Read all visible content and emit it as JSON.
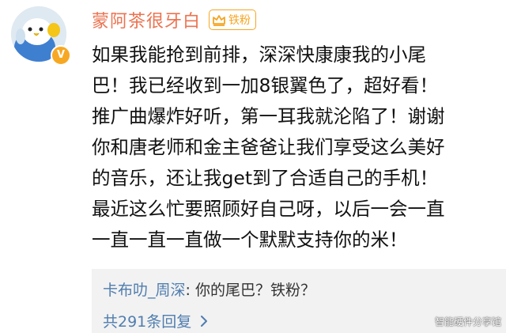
{
  "user": {
    "name": "蒙阿茶很牙白",
    "badge_label": "铁粉",
    "avatar_icon": "parrot-avatar-icon",
    "verified_icon": "verified-v-icon",
    "verified_mark": "V"
  },
  "post": {
    "lines": [
      "如果我能抢到前排，深深快康康我的小尾",
      "巴！我已经收到一加8银翼色了，超好看！",
      "推广曲爆炸好听，第一耳我就沦陷了！谢谢",
      "你和唐老师和金主爸爸让我们享受这么美好",
      "的音乐，还让我get到了合适自己的手机！",
      "最近这么忙要照顾好自己呀，以后一会一直",
      "一直一直一直做一个默默支持你的米！"
    ]
  },
  "reply": {
    "author": "卡布叻_周深",
    "text": ": 你的尾巴？铁粉？",
    "more_label": "共291条回复"
  },
  "watermark": "智能硬件分享馆",
  "colors": {
    "username": "#eb7350",
    "link": "#507daf",
    "badge": "#f5a623",
    "reply_bg": "#f2f2f2"
  }
}
